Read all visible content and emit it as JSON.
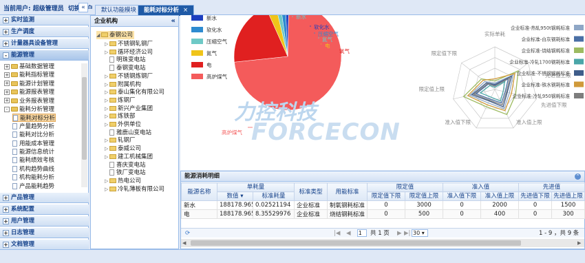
{
  "header": {
    "current_user": "当前用户: 超级管理员",
    "switch_user": "切换用户",
    "collapse_icon": "«"
  },
  "nav": {
    "sections_top": [
      {
        "label": "实时监测",
        "state": "+"
      },
      {
        "label": "生产调度",
        "state": "+"
      },
      {
        "label": "计量器具设备管理",
        "state": "+"
      },
      {
        "label": "能源管理",
        "state": "-"
      }
    ],
    "items": [
      {
        "label": "基础数据管理",
        "kind": "folder",
        "exp": "+"
      },
      {
        "label": "能耗指标管理",
        "kind": "folder",
        "exp": "+"
      },
      {
        "label": "能源计划管理",
        "kind": "folder",
        "exp": "+"
      },
      {
        "label": "能源报表管理",
        "kind": "folder",
        "exp": "+"
      },
      {
        "label": "业务报表管理",
        "kind": "folder",
        "exp": "+"
      },
      {
        "label": "能耗分析管理",
        "kind": "folder",
        "exp": "-"
      },
      {
        "label": "能耗对标分析",
        "kind": "doc",
        "selected": true
      },
      {
        "label": "产量趋势分析",
        "kind": "doc"
      },
      {
        "label": "能耗对比分析",
        "kind": "doc"
      },
      {
        "label": "用能成本管理",
        "kind": "doc"
      },
      {
        "label": "能源信息统计",
        "kind": "doc"
      },
      {
        "label": "能耗绩效考核",
        "kind": "doc"
      },
      {
        "label": "机构趋势曲线",
        "kind": "doc"
      },
      {
        "label": "机构能耗分析",
        "kind": "doc"
      },
      {
        "label": "产品能耗趋势",
        "kind": "doc"
      }
    ],
    "sections_bottom": [
      {
        "label": "产品管理",
        "state": "+"
      },
      {
        "label": "系统配置",
        "state": "+"
      },
      {
        "label": "用户管理",
        "state": "+"
      },
      {
        "label": "日志管理",
        "state": "+"
      },
      {
        "label": "文档管理",
        "state": "+"
      }
    ]
  },
  "tabs": [
    {
      "label": "默认功能模块"
    },
    {
      "label": "能耗对标分析",
      "close": "×"
    }
  ],
  "org": {
    "title": "企业机构",
    "collapse": "«",
    "root": "泰钢公司",
    "nodes": [
      {
        "label": "不锈钢轧钢厂",
        "kind": "folder"
      },
      {
        "label": "循环经济公司",
        "kind": "folder"
      },
      {
        "label": "明珠变电站",
        "kind": "page"
      },
      {
        "label": "泰钢变电站",
        "kind": "page"
      },
      {
        "label": "不锈钢炼钢厂",
        "kind": "folder"
      },
      {
        "label": "附属机构",
        "kind": "folder"
      },
      {
        "label": "泰山集化有限公司",
        "kind": "folder"
      },
      {
        "label": "炼钢厂",
        "kind": "folder"
      },
      {
        "label": "新兴产业集团",
        "kind": "folder"
      },
      {
        "label": "炼铁部",
        "kind": "folder"
      },
      {
        "label": "外供单位",
        "kind": "folder"
      },
      {
        "label": "雅鹿山变电站",
        "kind": "page"
      },
      {
        "label": "轧钢厂",
        "kind": "folder"
      },
      {
        "label": "泰威公司",
        "kind": "folder"
      },
      {
        "label": "建工机械集团",
        "kind": "folder"
      },
      {
        "label": "喜庆变电站",
        "kind": "page"
      },
      {
        "label": "铁厂变电站",
        "kind": "page"
      },
      {
        "label": "热电公司",
        "kind": "folder"
      },
      {
        "label": "冷轧薄板有限公司",
        "kind": "folder"
      }
    ]
  },
  "pie": {
    "legend": [
      {
        "label": "新水",
        "color": "#1d3fbf"
      },
      {
        "label": "软化水",
        "color": "#2e8bd0"
      },
      {
        "label": "压缩空气",
        "color": "#6ec9c6"
      },
      {
        "label": "氮气",
        "color": "#f0c419"
      },
      {
        "label": "电",
        "color": "#e02020"
      },
      {
        "label": "高炉煤气",
        "color": "#f45b5b"
      }
    ],
    "labels": [
      "新水",
      "软化水",
      "压缩空气",
      "氮气",
      "电",
      "氧气",
      "高炉煤气"
    ],
    "slices": [
      {
        "name": "高炉煤气",
        "value": 73,
        "color": "#f45b5b"
      },
      {
        "name": "电",
        "value": 20,
        "color": "#e02020"
      },
      {
        "name": "氮气",
        "value": 3,
        "color": "#f0c419"
      },
      {
        "name": "压缩空气",
        "value": 1.5,
        "color": "#6ec9c6"
      },
      {
        "name": "软化水",
        "value": 1.5,
        "color": "#2e8bd0"
      },
      {
        "name": "新水",
        "value": 1,
        "color": "#1d3fbf"
      }
    ]
  },
  "radar": {
    "axes": [
      "实际单耗",
      "先进值上限",
      "先进值下限",
      "准入值上限",
      "准入值下限",
      "限定值上限",
      "限定值下限"
    ],
    "legend": [
      {
        "label": "企业标准-热轧950t钢耗标准",
        "color": "#8fa7c6"
      },
      {
        "label": "企业标准-白灰钢耗标准",
        "color": "#4a6fa5"
      },
      {
        "label": "企业标准-烧结钢耗标准",
        "color": "#9dbb61"
      },
      {
        "label": "企业标准-冷轧1700钢耗标准",
        "color": "#4aa6a8"
      },
      {
        "label": "企业标准-不锈钢钢耗标准",
        "color": "#3f5d8a"
      },
      {
        "label": "企业标准-铁水钢耗标准",
        "color": "#d09a3a"
      },
      {
        "label": "企业标准-冷轧950钢耗标准",
        "color": "#7d7d7d"
      }
    ],
    "series": [
      [
        0.15,
        0.55,
        0.35,
        0.5,
        0.35,
        0.6,
        0.3
      ],
      [
        0.1,
        0.4,
        0.25,
        0.35,
        0.25,
        0.45,
        0.2
      ],
      [
        0.2,
        0.7,
        0.5,
        0.65,
        0.45,
        0.75,
        0.4
      ],
      [
        0.05,
        0.3,
        0.2,
        0.3,
        0.2,
        0.35,
        0.15
      ],
      [
        0.12,
        0.5,
        0.3,
        0.45,
        0.3,
        0.55,
        0.25
      ],
      [
        0.25,
        0.6,
        0.4,
        0.55,
        0.4,
        0.65,
        0.35
      ],
      [
        0.08,
        0.45,
        0.28,
        0.4,
        0.28,
        0.5,
        0.22
      ]
    ]
  },
  "watermark": {
    "cn": "力控科技",
    "en": "FORCECON"
  },
  "table": {
    "title": "能源消耗明细",
    "group_headers": [
      "能源名称",
      "单耗量",
      "标准类型",
      "用能标准",
      "限定值",
      "准入值",
      "先进值"
    ],
    "sub_headers": [
      "数值",
      "标准耗量",
      "限定值下限",
      "限定值上限",
      "准入值下限",
      "准入值上限",
      "先进值下限",
      "先进值上限"
    ],
    "sort_icon": "▾",
    "rows": [
      [
        "新水",
        "188178.965",
        "0.02521194",
        "企业标准",
        "制氧钢耗标准",
        "0",
        "3000",
        "0",
        "2000",
        "0",
        "1500"
      ],
      [
        "电",
        "188178.965",
        "8.35529976",
        "企业标准",
        "烧结钢耗标准",
        "0",
        "500",
        "0",
        "400",
        "0",
        "300"
      ]
    ]
  },
  "pager": {
    "page": "1",
    "of": "共 1 页",
    "size": "30",
    "summary": "1 - 9 ，共 9 条",
    "first": "|◀",
    "prev": "◀",
    "next": "▶",
    "last": "▶|",
    "refresh": "⟳"
  }
}
